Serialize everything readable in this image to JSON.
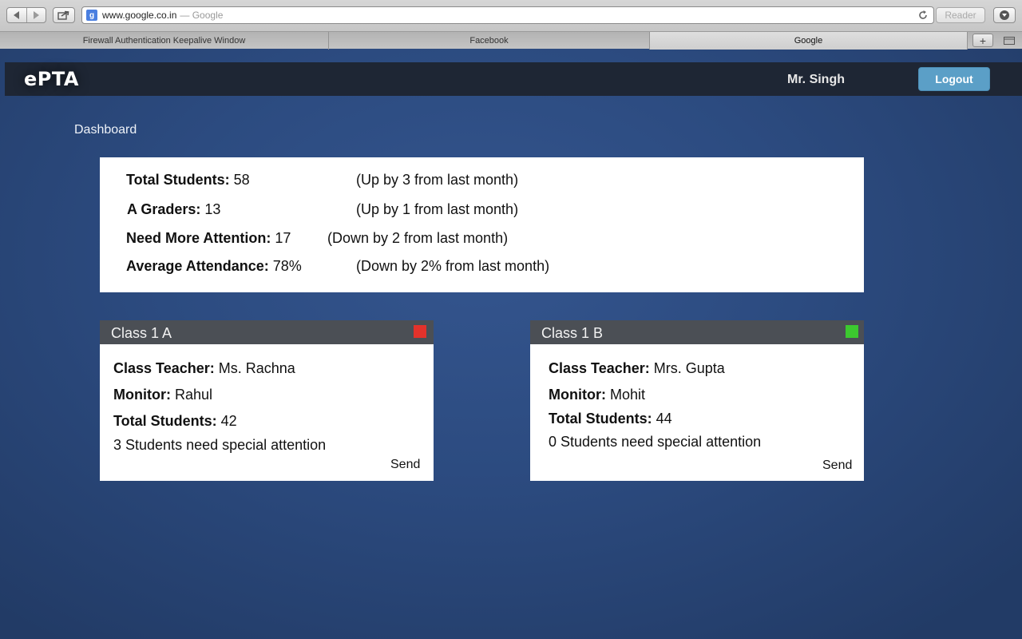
{
  "browser": {
    "url": "www.google.co.in",
    "page_title_suffix": "— Google",
    "reader_label": "Reader",
    "favicon_letter": "g",
    "tabs": [
      {
        "label": "Firewall Authentication Keepalive Window"
      },
      {
        "label": "Facebook"
      },
      {
        "label": "Google"
      }
    ],
    "new_tab_symbol": "+"
  },
  "header": {
    "logo": "ePTA",
    "user": "Mr. Singh",
    "logout_label": "Logout"
  },
  "page": {
    "title": "Dashboard"
  },
  "summary": {
    "total_students": {
      "label": "Total Students:",
      "value": "58",
      "trend": "(Up by 3 from last month)"
    },
    "a_graders": {
      "label": "A Graders:",
      "value": "13",
      "trend": "(Up by 1 from last month)"
    },
    "need_attention": {
      "label": "Need More Attention:",
      "value": "17",
      "trend": "(Down by 2 from last month)"
    },
    "avg_attendance": {
      "label": "Average Attendance:",
      "value": "78%",
      "trend": "(Down by 2% from last month)"
    }
  },
  "classes": [
    {
      "name": "Class 1 A",
      "status_color": "#e3322b",
      "teacher_label": "Class Teacher:",
      "teacher": "Ms. Rachna",
      "monitor_label": "Monitor:",
      "monitor": "Rahul",
      "students_label": "Total Students:",
      "students": "42",
      "attention_text": "3 Students need special attention",
      "send_label": "Send"
    },
    {
      "name": "Class 1 B",
      "status_color": "#3cc92f",
      "teacher_label": "Class Teacher:",
      "teacher": "Mrs. Gupta",
      "monitor_label": "Monitor:",
      "monitor": "Mohit",
      "students_label": "Total Students:",
      "students": "44",
      "attention_text": "0 Students need special attention",
      "send_label": "Send"
    }
  ],
  "colors": {
    "header_bg": "#1e2634",
    "logout_bg": "#5b9fc7",
    "card_header_bg": "#4b4f55",
    "page_bg": "#2c4b80"
  }
}
